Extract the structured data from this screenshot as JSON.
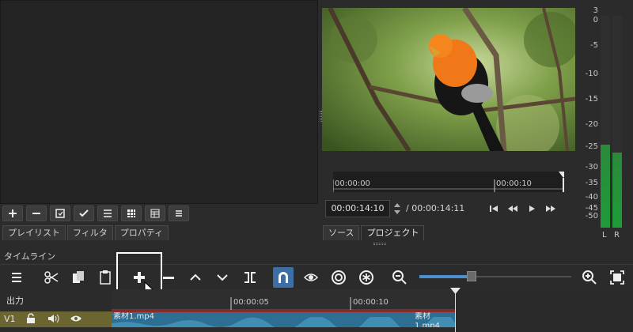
{
  "playlist": {
    "toolbar": [
      "plus-icon",
      "minus-icon",
      "export-icon",
      "check-icon",
      "list-icon",
      "grid-icon",
      "table-icon",
      "menu-icon"
    ],
    "tabs": [
      "プレイリスト",
      "フィルタ",
      "プロパティ"
    ]
  },
  "viewer": {
    "scrubber_ticks": [
      "00:00:00",
      "00:00:10"
    ],
    "timecode": "00:00:14:10",
    "duration": "/ 00:00:14:11",
    "tabs": [
      "ソース",
      "プロジェクト"
    ]
  },
  "meter": {
    "labels": [
      "3",
      "0",
      "-5",
      "-10",
      "-15",
      "-20",
      "-25",
      "-30",
      "-35",
      "-40",
      "-45",
      "-50"
    ],
    "channels": [
      "L",
      "R"
    ],
    "level_L_db": -25,
    "level_R_db": -27
  },
  "timeline": {
    "title": "タイムライン",
    "output_label": "出力",
    "track_name": "V1",
    "ruler_ticks": [
      "00:00:05",
      "00:00:10"
    ],
    "clip_name": "素材1.mp4",
    "zoom_level": 0.34
  },
  "colors": {
    "accent": "#3d6fa6",
    "clip": "#2c6f93",
    "track": "#6b6531",
    "meter": "#1f9b38"
  }
}
